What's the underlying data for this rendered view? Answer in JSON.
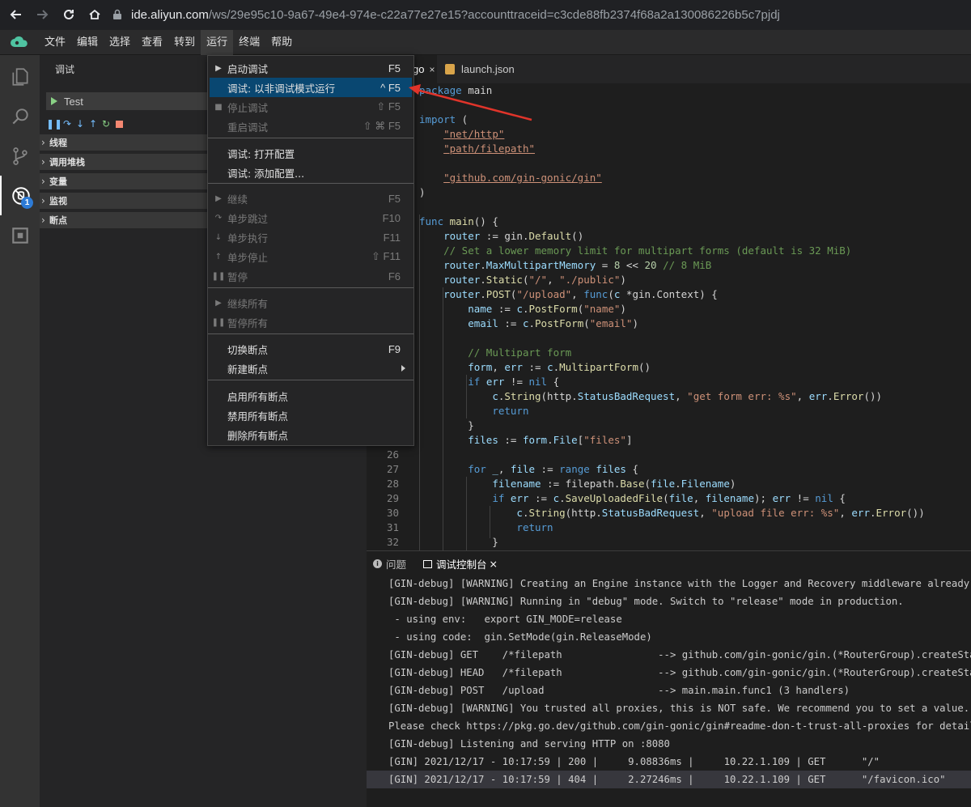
{
  "browser": {
    "url_host": "ide.aliyun.com",
    "url_path": "/ws/29e95c10-9a67-49e4-974e-c22a77e27e15?accounttraceid=c3cde88fb2374f68a2a130086226b5c7pjdj"
  },
  "menubar": {
    "items": [
      "文件",
      "编辑",
      "选择",
      "查看",
      "转到",
      "运行",
      "终端",
      "帮助"
    ],
    "active_index": 5
  },
  "sidebar": {
    "title": "调试",
    "config_name": "Test",
    "sections": [
      "线程",
      "调用堆栈",
      "变量",
      "监视",
      "断点"
    ]
  },
  "activity": {
    "debug_badge": "1"
  },
  "tabs": {
    "tab1_label": "go",
    "tab1_close": "×",
    "tab2_label": "launch.json"
  },
  "dropdown": {
    "items": [
      {
        "label": "启动调试",
        "key": "F5",
        "state": "normal",
        "icon": "play"
      },
      {
        "label": "调试: 以非调试模式运行",
        "key": "^ F5",
        "state": "highlighted",
        "icon": ""
      },
      {
        "label": "停止调试",
        "key": "⇧ F5",
        "state": "disabled",
        "icon": "stop"
      },
      {
        "label": "重启调试",
        "key": "⇧ ⌘ F5",
        "state": "disabled",
        "icon": ""
      },
      {
        "label": "调试: 打开配置",
        "key": "",
        "state": "normal",
        "icon": ""
      },
      {
        "label": "调试: 添加配置...",
        "key": "",
        "state": "normal",
        "icon": ""
      },
      {
        "label": "继续",
        "key": "F5",
        "state": "disabled",
        "icon": "continue"
      },
      {
        "label": "单步跳过",
        "key": "F10",
        "state": "disabled",
        "icon": "step-over"
      },
      {
        "label": "单步执行",
        "key": "F11",
        "state": "disabled",
        "icon": "step-into"
      },
      {
        "label": "单步停止",
        "key": "⇧ F11",
        "state": "disabled",
        "icon": "step-out"
      },
      {
        "label": "暂停",
        "key": "F6",
        "state": "disabled",
        "icon": "pause"
      },
      {
        "label": "继续所有",
        "key": "",
        "state": "disabled",
        "icon": "continue"
      },
      {
        "label": "暂停所有",
        "key": "",
        "state": "disabled",
        "icon": "pause"
      },
      {
        "label": "切换断点",
        "key": "F9",
        "state": "normal",
        "icon": ""
      },
      {
        "label": "新建断点",
        "key": "",
        "state": "normal",
        "icon": "",
        "submenu": true
      },
      {
        "label": "启用所有断点",
        "key": "",
        "state": "normal",
        "icon": ""
      },
      {
        "label": "禁用所有断点",
        "key": "",
        "state": "normal",
        "icon": ""
      },
      {
        "label": "删除所有断点",
        "key": "",
        "state": "normal",
        "icon": ""
      }
    ]
  },
  "editor": {
    "visible_line_numbers": [
      "26",
      "27",
      "28",
      "29",
      "30",
      "31",
      "32"
    ]
  },
  "panel": {
    "tab_problems": "问题",
    "tab_console": "调试控制台",
    "tab_console_close": "×",
    "console_lines": [
      "[GIN-debug] [WARNING] Creating an Engine instance with the Logger and Recovery middleware already at",
      "[GIN-debug] [WARNING] Running in \"debug\" mode. Switch to \"release\" mode in production.",
      " - using env:   export GIN_MODE=release",
      " - using code:  gin.SetMode(gin.ReleaseMode)",
      "[GIN-debug] GET    /*filepath                --> github.com/gin-gonic/gin.(*RouterGroup).createStati",
      "[GIN-debug] HEAD   /*filepath                --> github.com/gin-gonic/gin.(*RouterGroup).createStati",
      "[GIN-debug] POST   /upload                   --> main.main.func1 (3 handlers)",
      "[GIN-debug] [WARNING] You trusted all proxies, this is NOT safe. We recommend you to set a value.",
      "Please check https://pkg.go.dev/github.com/gin-gonic/gin#readme-don-t-trust-all-proxies for details.",
      "[GIN-debug] Listening and serving HTTP on :8080",
      "[GIN] 2021/12/17 - 10:17:59 | 200 |     9.08836ms |     10.22.1.109 | GET      \"/\"",
      "[GIN] 2021/12/17 - 10:17:59 | 404 |     2.27246ms |     10.22.1.109 | GET      \"/favicon.ico\""
    ],
    "selected_line_index": 11
  },
  "colors": {
    "accent": "#094771",
    "annotation_arrow": "#e0342a"
  }
}
